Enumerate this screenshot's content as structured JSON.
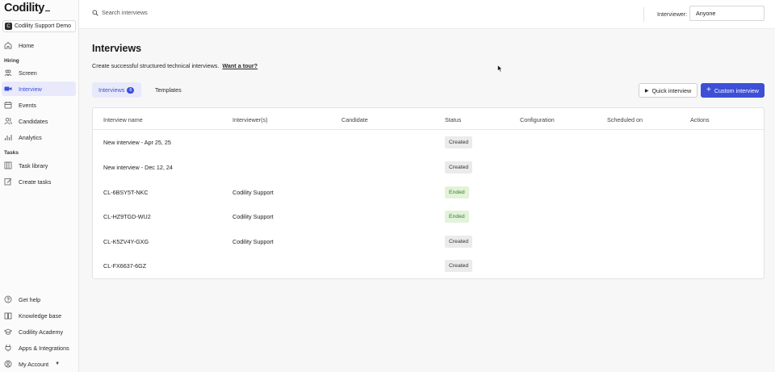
{
  "app": {
    "logo": "Codility",
    "org_initial": "C",
    "org_name": "Codility Support Demo"
  },
  "sidebar": {
    "home": "Home",
    "hiring_label": "Hiring",
    "hiring_items": [
      {
        "label": "Screen",
        "icon": "screen-icon"
      },
      {
        "label": "Interview",
        "icon": "video-icon",
        "active": true
      },
      {
        "label": "Events",
        "icon": "calendar-icon"
      },
      {
        "label": "Candidates",
        "icon": "users-icon"
      },
      {
        "label": "Analytics",
        "icon": "chart-icon"
      }
    ],
    "tasks_label": "Tasks",
    "tasks_items": [
      {
        "label": "Task library",
        "icon": "library-icon"
      },
      {
        "label": "Create tasks",
        "icon": "edit-icon"
      }
    ],
    "bottom_items": [
      {
        "label": "Get help",
        "icon": "help-icon"
      },
      {
        "label": "Knowledge base",
        "icon": "book-icon"
      },
      {
        "label": "Codility Academy",
        "icon": "academy-icon"
      },
      {
        "label": "Apps & Integrations",
        "icon": "integrations-icon"
      },
      {
        "label": "My Account",
        "icon": "account-icon"
      }
    ]
  },
  "topbar": {
    "search_placeholder": "Search interviews",
    "interviewer_label": "Interviewer:",
    "interviewer_value": "Anyone"
  },
  "main": {
    "title": "Interviews",
    "subtitle": "Create successful structured technical interviews.",
    "tour_link": "Want a tour?",
    "tabs": [
      {
        "label": "Interviews",
        "count": "6",
        "active": true
      },
      {
        "label": "Templates"
      }
    ],
    "quick_button": "Quick interview",
    "custom_button": "Custom interview"
  },
  "table": {
    "columns": [
      "Interview name",
      "Interviewer(s)",
      "Candidate",
      "Status",
      "Configuration",
      "Scheduled on",
      "Actions"
    ],
    "rows": [
      {
        "name": "New interview - Apr 25, 25",
        "interviewer": "",
        "candidate": "",
        "status": "Created"
      },
      {
        "name": "New interview - Dec 12, 24",
        "interviewer": "",
        "candidate": "",
        "status": "Created"
      },
      {
        "name": "CL-6BSY5T-NKC",
        "interviewer": "Codility Support",
        "candidate": "",
        "status": "Ended"
      },
      {
        "name": "CL-HZ9TGD-WU2",
        "interviewer": "Codility Support",
        "candidate": "",
        "status": "Ended"
      },
      {
        "name": "CL-K5ZV4Y-GXG",
        "interviewer": "Codility Support",
        "candidate": "",
        "status": "Created"
      },
      {
        "name": "CL-FX6637-6GZ",
        "interviewer": "",
        "candidate": "",
        "status": "Created"
      }
    ]
  },
  "colors": {
    "accent": "#3c4fd6",
    "accent_bg": "#e8eafb",
    "ended_bg": "#e2f3da",
    "ended_text": "#3a7f2a",
    "created_bg": "#ebebeb"
  }
}
